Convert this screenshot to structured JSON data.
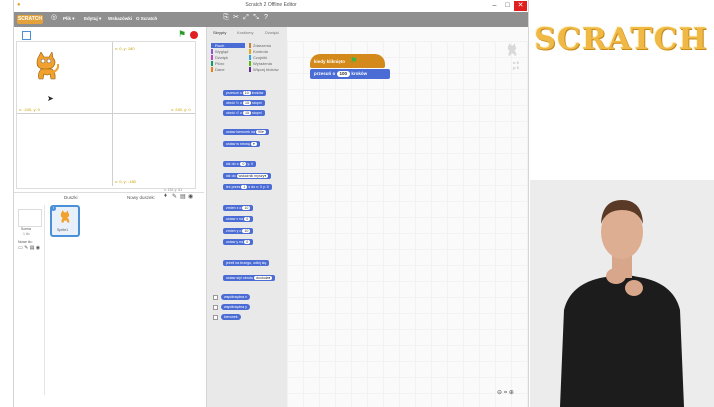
{
  "window": {
    "title": "Scratch 2 Offline Editor",
    "controls": [
      "–",
      "□",
      "✕"
    ]
  },
  "menubar": {
    "logo": "SCRATCH",
    "menus": [
      "Plik ▾",
      "Edytuj ▾",
      "Wskazówki",
      "O Scratch"
    ],
    "icons": [
      "duplicate-icon",
      "delete-icon",
      "grow-icon",
      "shrink-icon",
      "help-icon"
    ]
  },
  "stage": {
    "coords": {
      "top": "x: 0, y: 180",
      "bottom": "x: 0, y: -180",
      "left": "x: -240, y: 0",
      "right": "x: 240, y: 0"
    },
    "mouse_readout": "x: 151 y: 51"
  },
  "sprites": {
    "header": "Duszki",
    "new_sprite_label": "Nowy duszek:",
    "stage_label": "Scena",
    "stage_sub": "1 tło",
    "new_backdrop_label": "Nowe tło:",
    "sprite_name": "Sprite1",
    "sprite_badge": "i"
  },
  "palette": {
    "tabs": [
      "Skrypty",
      "Kostiumy",
      "Dźwięki"
    ],
    "categories_left": [
      "Ruch",
      "Wygląd",
      "Dźwięk",
      "Pióro",
      "Dane"
    ],
    "categories_right": [
      "Zdarzenia",
      "Kontrola",
      "Czujniki",
      "Wyrażenia",
      "Więcej bloków"
    ],
    "category_colors": [
      "#4a6cd4",
      "#8a55d7",
      "#bb42c3",
      "#0e9a6c",
      "#ee7d16",
      "#c88330",
      "#e1a91a",
      "#2ca5e2",
      "#5cb712",
      "#632d99"
    ],
    "blocks": [
      {
        "text": "przesuń o",
        "pill": "10",
        "tail": "kroków"
      },
      {
        "text": "obróć ↻ o",
        "pill": "15",
        "tail": "stopni"
      },
      {
        "text": "obróć ↺ o",
        "pill": "15",
        "tail": "stopni"
      },
      {
        "text": "ustaw kierunek na",
        "pill": "90▾",
        "tail": ""
      },
      {
        "text": "ustaw w stronę",
        "pill": "▾",
        "tail": ""
      },
      {
        "text": "idź do x:",
        "pill": "0",
        "tail": "y: 0"
      },
      {
        "text": "idź do",
        "pill": "wskaźnik myszy▾",
        "tail": ""
      },
      {
        "text": "leć przez",
        "pill": "1",
        "tail": "s do x: 0 y: 0"
      },
      {
        "text": "zmień x o",
        "pill": "10",
        "tail": ""
      },
      {
        "text": "ustaw x na",
        "pill": "0",
        "tail": ""
      },
      {
        "text": "zmień y o",
        "pill": "10",
        "tail": ""
      },
      {
        "text": "ustaw y na",
        "pill": "0",
        "tail": ""
      },
      {
        "text": "jeżeli na brzegu, odbij się",
        "pill": "",
        "tail": ""
      },
      {
        "text": "ustaw styl obrotu",
        "pill": "dookoła▾",
        "tail": ""
      }
    ],
    "reporters": [
      "współrzędna x",
      "współrzędna y",
      "kierunek"
    ]
  },
  "scripts": {
    "hat_label": "kiedy kliknięto",
    "move_label": "przesuń o",
    "move_value": "100",
    "move_unit": "kroków",
    "sprite_coords_x": "x: 0",
    "sprite_coords_y": "y: 0",
    "zoom": [
      "⊖",
      "=",
      "⊕"
    ]
  },
  "brand": {
    "logo_text": "SCRATCH"
  }
}
